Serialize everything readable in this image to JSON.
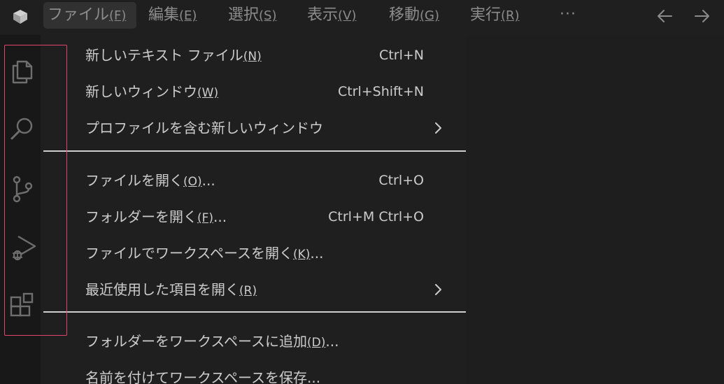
{
  "menubar": {
    "items": [
      {
        "label": "ファイル",
        "mnemonic": "(F)"
      },
      {
        "label": "編集",
        "mnemonic": "(E)"
      },
      {
        "label": "選択",
        "mnemonic": "(S)"
      },
      {
        "label": "表示",
        "mnemonic": "(V)"
      },
      {
        "label": "移動",
        "mnemonic": "(G)"
      },
      {
        "label": "実行",
        "mnemonic": "(R)"
      }
    ],
    "more": "···"
  },
  "file_menu": {
    "items": [
      {
        "label": "新しいテキスト ファイル",
        "mnemonic": "(N)",
        "suffix": "",
        "shortcut": "Ctrl+N"
      },
      {
        "label": "新しいウィンドウ",
        "mnemonic": "(W)",
        "suffix": "",
        "shortcut": "Ctrl+Shift+N"
      },
      {
        "label": "プロファイルを含む新しいウィンドウ",
        "mnemonic": "",
        "suffix": "",
        "shortcut": ""
      },
      {
        "label": "ファイルを開く",
        "mnemonic": "(O)",
        "suffix": "...",
        "shortcut": "Ctrl+O"
      },
      {
        "label": "フォルダーを開く",
        "mnemonic": "(F)",
        "suffix": "...",
        "shortcut": "Ctrl+M Ctrl+O"
      },
      {
        "label": "ファイルでワークスペースを開く",
        "mnemonic": "(K)",
        "suffix": "...",
        "shortcut": ""
      },
      {
        "label": "最近使用した項目を開く",
        "mnemonic": "(R)",
        "suffix": "",
        "shortcut": ""
      },
      {
        "label": "フォルダーをワークスペースに追加",
        "mnemonic": "(D)",
        "suffix": "...",
        "shortcut": ""
      },
      {
        "label": "名前を付けてワークスペースを保存...",
        "mnemonic": "",
        "suffix": "",
        "shortcut": ""
      }
    ]
  },
  "icons": {
    "app": "vscode-logo-icon",
    "back": "arrow-left-icon",
    "forward": "arrow-right-icon",
    "explorer": "files-icon",
    "search": "search-icon",
    "scm": "source-control-icon",
    "debug": "run-debug-icon",
    "extensions": "extensions-icon",
    "submenu": "chevron-right-icon"
  },
  "colors": {
    "focus_border": "#e0456b",
    "menu_bg": "#1f1f1f",
    "active_menu_bg": "#313131"
  }
}
